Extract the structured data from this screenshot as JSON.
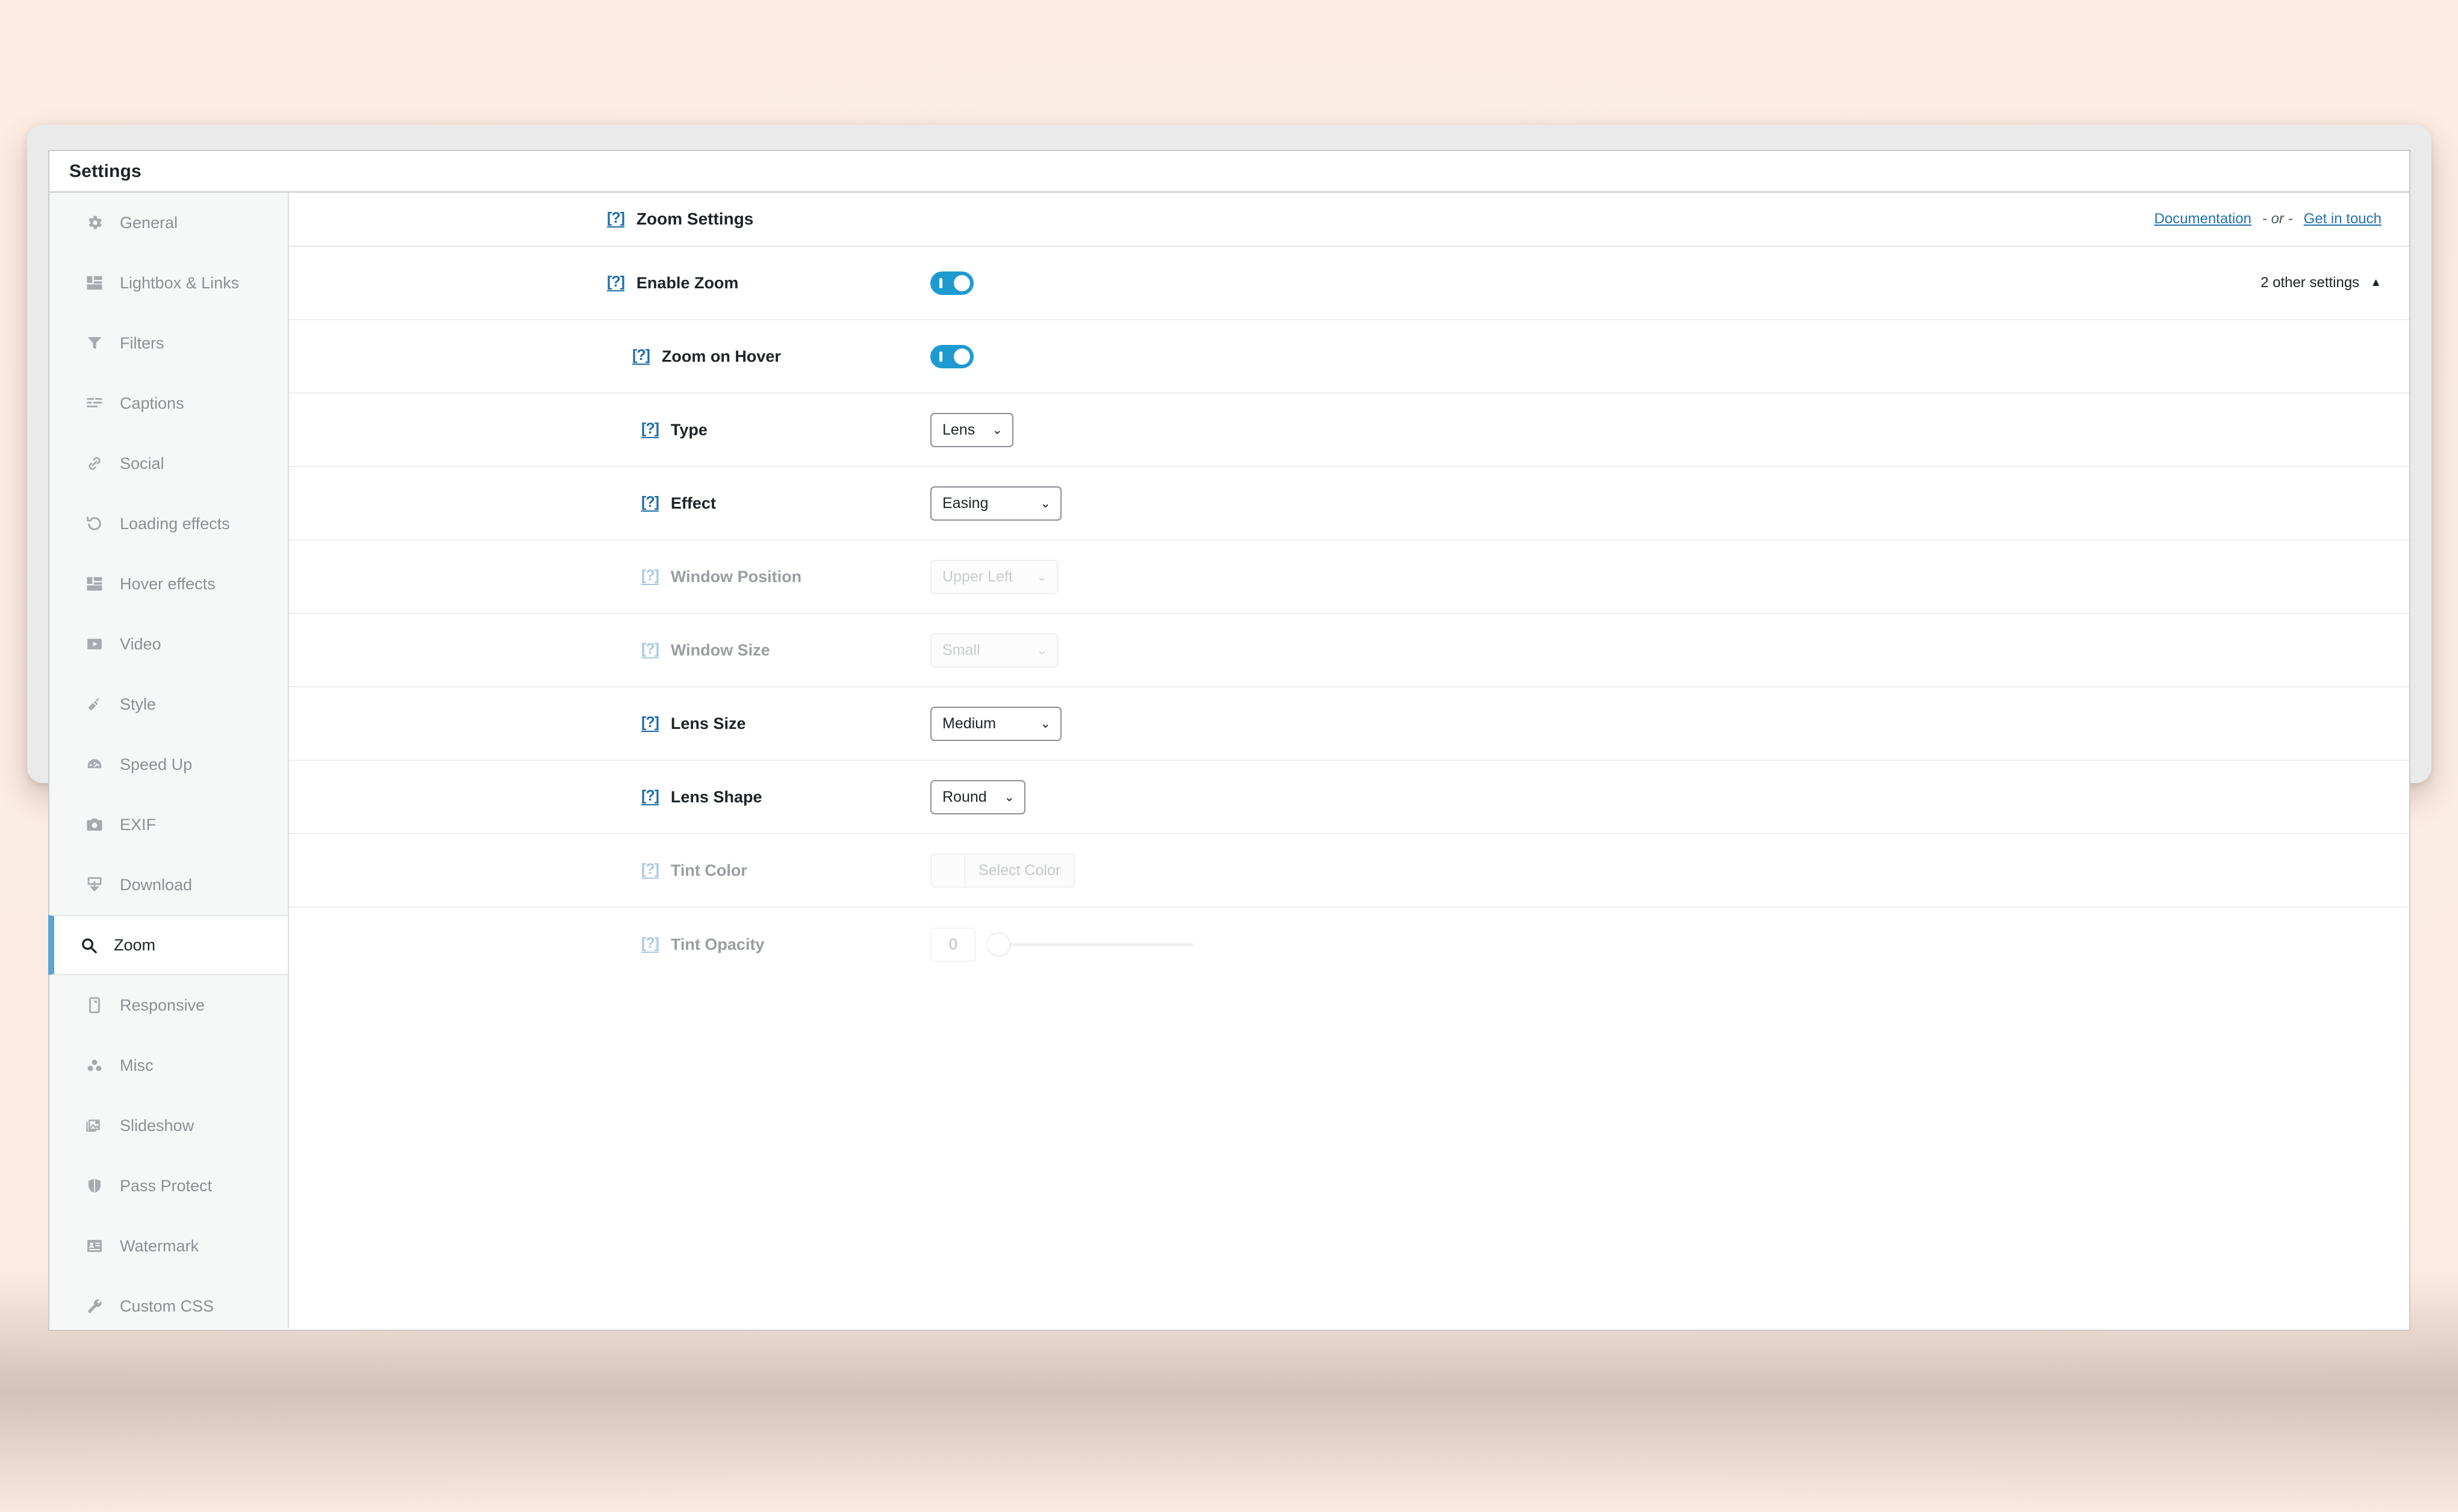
{
  "panel": {
    "title": "Settings"
  },
  "sidebar": {
    "items": [
      {
        "label": "General",
        "icon": "gear-icon",
        "active": false
      },
      {
        "label": "Lightbox & Links",
        "icon": "layout-icon",
        "active": false
      },
      {
        "label": "Filters",
        "icon": "funnel-icon",
        "active": false
      },
      {
        "label": "Captions",
        "icon": "text-lines-icon",
        "active": false
      },
      {
        "label": "Social",
        "icon": "link-icon",
        "active": false
      },
      {
        "label": "Loading effects",
        "icon": "refresh-icon",
        "active": false
      },
      {
        "label": "Hover effects",
        "icon": "layout-icon",
        "active": false
      },
      {
        "label": "Video",
        "icon": "play-icon",
        "active": false
      },
      {
        "label": "Style",
        "icon": "brush-icon",
        "active": false
      },
      {
        "label": "Speed Up",
        "icon": "gauge-icon",
        "active": false
      },
      {
        "label": "EXIF",
        "icon": "camera-icon",
        "active": false
      },
      {
        "label": "Download",
        "icon": "download-icon",
        "active": false
      },
      {
        "label": "Zoom",
        "icon": "search-icon",
        "active": true
      },
      {
        "label": "Responsive",
        "icon": "mobile-icon",
        "active": false
      },
      {
        "label": "Misc",
        "icon": "dots-icon",
        "active": false
      },
      {
        "label": "Slideshow",
        "icon": "images-icon",
        "active": false
      },
      {
        "label": "Pass Protect",
        "icon": "shield-icon",
        "active": false
      },
      {
        "label": "Watermark",
        "icon": "id-card-icon",
        "active": false
      },
      {
        "label": "Custom CSS",
        "icon": "wrench-icon",
        "active": false
      }
    ]
  },
  "header": {
    "help_glyph": "[?]",
    "title": "Zoom Settings",
    "documentation_link": "Documentation",
    "or_separator": "- or -",
    "contact_link": "Get in touch"
  },
  "rows": {
    "enable_zoom": {
      "help_glyph": "[?]",
      "label": "Enable Zoom",
      "toggle_state": "on",
      "other_settings_label": "2 other settings",
      "other_settings_caret": "▲"
    },
    "zoom_on_hover": {
      "help_glyph": "[?]",
      "label": "Zoom on Hover",
      "toggle_state": "on"
    },
    "type": {
      "help_glyph": "[?]",
      "label": "Type",
      "value": "Lens",
      "chevron": "⌄",
      "disabled": false
    },
    "effect": {
      "help_glyph": "[?]",
      "label": "Effect",
      "value": "Easing",
      "chevron": "⌄",
      "disabled": false
    },
    "window_position": {
      "help_glyph": "[?]",
      "label": "Window Position",
      "value": "Upper Left",
      "chevron": "⌄",
      "disabled": true
    },
    "window_size": {
      "help_glyph": "[?]",
      "label": "Window Size",
      "value": "Small",
      "chevron": "⌄",
      "disabled": true
    },
    "lens_size": {
      "help_glyph": "[?]",
      "label": "Lens Size",
      "value": "Medium",
      "chevron": "⌄",
      "disabled": false
    },
    "lens_shape": {
      "help_glyph": "[?]",
      "label": "Lens Shape",
      "value": "Round",
      "chevron": "⌄",
      "disabled": false
    },
    "tint_color": {
      "help_glyph": "[?]",
      "label": "Tint Color",
      "button_label": "Select Color",
      "disabled": true
    },
    "tint_opacity": {
      "help_glyph": "[?]",
      "label": "Tint Opacity",
      "value": "0",
      "disabled": true
    }
  },
  "colors": {
    "accent_toggle": "#1d9bd1",
    "active_item_border": "#5ba4cf",
    "link": "#2271b1",
    "help_enabled": "#1a6ca8",
    "help_disabled": "#a8c9e2",
    "page_background": "#fdeee5",
    "sidebar_background": "#f6f7f7"
  }
}
